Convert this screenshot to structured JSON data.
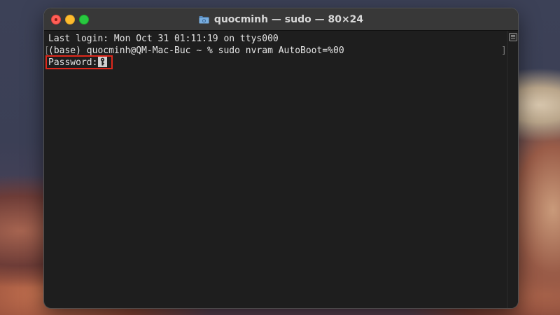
{
  "window": {
    "title": "quocminh — sudo — 80×24"
  },
  "terminal": {
    "lines": [
      "Last login: Mon Oct 31 01:11:19 on ttys000",
      "(base) quocminh@QM-Mac-Buc ~ % sudo nvram AutoBoot=%00",
      "Password:"
    ],
    "bracket_left": "[",
    "bracket_right": "]"
  },
  "colors": {
    "highlight_box": "#e0281c",
    "terminal_bg": "#1e1e1e",
    "terminal_text": "#e6e6e6"
  }
}
